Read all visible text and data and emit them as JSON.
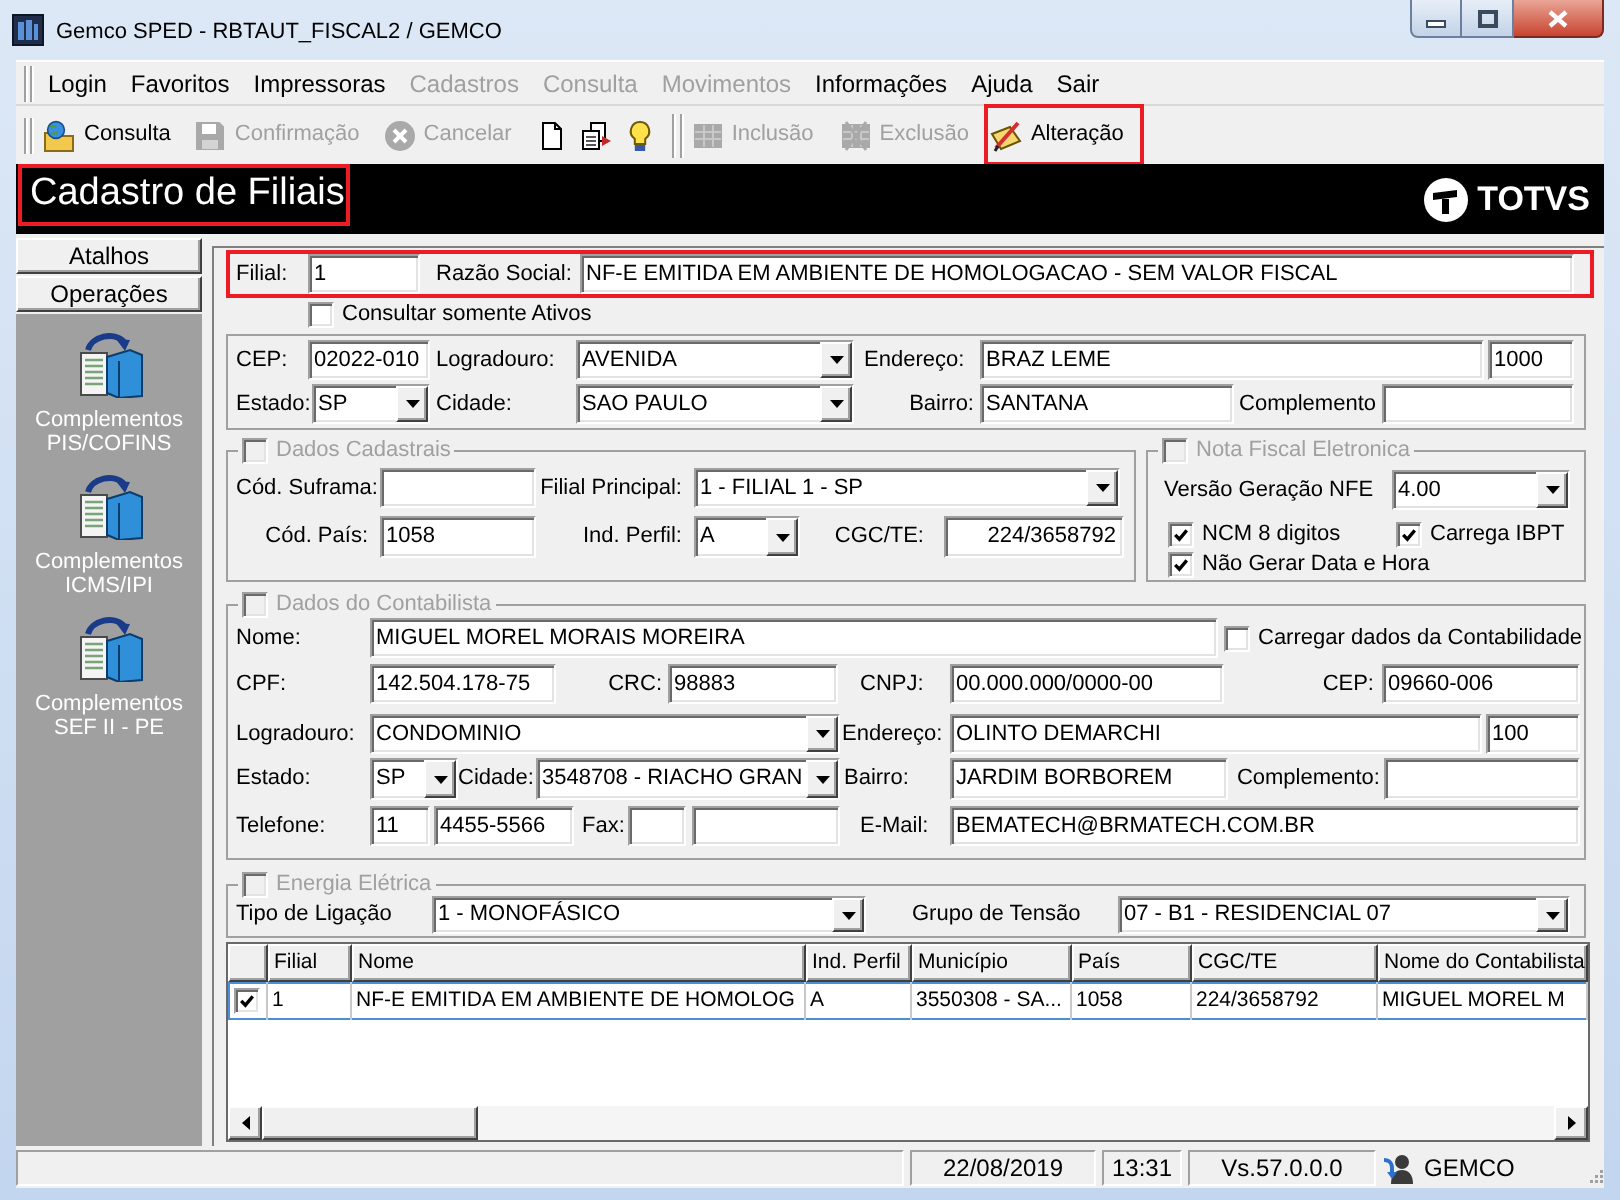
{
  "window": {
    "title": "Gemco SPED - RBTAUT_FISCAL2 / GEMCO"
  },
  "menu": [
    {
      "label": "Login",
      "disabled": false
    },
    {
      "label": "Favoritos",
      "disabled": false
    },
    {
      "label": "Impressoras",
      "disabled": false
    },
    {
      "label": "Cadastros",
      "disabled": true
    },
    {
      "label": "Consulta",
      "disabled": true
    },
    {
      "label": "Movimentos",
      "disabled": true
    },
    {
      "label": "Informações",
      "disabled": false
    },
    {
      "label": "Ajuda",
      "disabled": false
    },
    {
      "label": "Sair",
      "disabled": false
    }
  ],
  "toolbar": [
    {
      "kind": "button",
      "label": "Consulta",
      "disabled": false,
      "highlighted": false
    },
    {
      "kind": "button",
      "label": "Confirmação",
      "disabled": true,
      "highlighted": false
    },
    {
      "kind": "button",
      "label": "Cancelar",
      "disabled": true,
      "highlighted": false
    },
    {
      "kind": "icon_button",
      "disabled": false,
      "highlighted": false
    },
    {
      "kind": "icon_button",
      "disabled": false,
      "highlighted": false
    },
    {
      "kind": "icon_button",
      "disabled": false,
      "highlighted": false
    },
    {
      "kind": "separator"
    },
    {
      "kind": "button",
      "label": "Inclusão",
      "disabled": true,
      "highlighted": false
    },
    {
      "kind": "button",
      "label": "Exclusão",
      "disabled": true,
      "highlighted": false
    },
    {
      "kind": "button",
      "label": "Alteração",
      "disabled": false,
      "highlighted": true
    }
  ],
  "header": {
    "title": "Cadastro de Filiais",
    "highlighted": true,
    "logo_text": "TOTVS"
  },
  "sidebar": {
    "tabs": [
      "Atalhos",
      "Operações"
    ],
    "items": [
      "Complementos PIS/COFINS",
      "Complementos ICMS/IPI",
      "Complementos SEF II - PE"
    ]
  },
  "form": {
    "filial_row": {
      "highlighted": true,
      "items": [
        {
          "kind": "label",
          "text": "Filial:"
        },
        {
          "kind": "input",
          "value": "1"
        },
        {
          "kind": "label",
          "text": "Razão Social:"
        },
        {
          "kind": "input",
          "value": "NF-E EMITIDA EM AMBIENTE DE HOMOLOGACAO - SEM VALOR FISCAL"
        }
      ]
    },
    "only_active": {
      "label": "Consultar somente Ativos",
      "checked": false
    },
    "address": {
      "rows": [
        [
          {
            "kind": "label",
            "text": "CEP:"
          },
          {
            "kind": "input",
            "value": "02022-010"
          },
          {
            "kind": "label",
            "text": "Logradouro:"
          },
          {
            "kind": "combo",
            "value": "AVENIDA"
          },
          {
            "kind": "label",
            "text": "Endereço:"
          },
          {
            "kind": "input",
            "value": "BRAZ LEME"
          },
          {
            "kind": "input",
            "value": "1000"
          }
        ],
        [
          {
            "kind": "label",
            "text": "Estado:"
          },
          {
            "kind": "combo",
            "value": "SP"
          },
          {
            "kind": "label",
            "text": "Cidade:"
          },
          {
            "kind": "combo",
            "value": "SAO PAULO"
          },
          {
            "kind": "label",
            "text": "Bairro:"
          },
          {
            "kind": "input",
            "value": "SANTANA"
          },
          {
            "kind": "label",
            "text": "Complemento"
          },
          {
            "kind": "input"
          }
        ]
      ]
    },
    "dados_cadastrais": {
      "title": "Dados Cadastrais",
      "checked": false,
      "disabled": true,
      "rows": [
        [
          {
            "kind": "label",
            "text": "Cód. Suframa:"
          },
          {
            "kind": "input"
          },
          {
            "kind": "label",
            "text": "Filial Principal:"
          },
          {
            "kind": "combo",
            "value": "1 - FILIAL 1 - SP"
          }
        ],
        [
          {
            "kind": "label",
            "text": "Cód. País:"
          },
          {
            "kind": "input",
            "value": "1058"
          },
          {
            "kind": "label",
            "text": "Ind. Perfil:"
          },
          {
            "kind": "combo",
            "value": "A"
          },
          {
            "kind": "label",
            "text": "CGC/TE:"
          },
          {
            "kind": "input",
            "value": "224/3658792"
          }
        ]
      ]
    },
    "nota_fiscal": {
      "title": "Nota Fiscal Eletronica",
      "checked": false,
      "disabled": true,
      "rows": [
        [
          {
            "kind": "label",
            "text": "Versão Geração NFE"
          },
          {
            "kind": "combo",
            "value": "4.00"
          }
        ],
        [
          {
            "kind": "check",
            "label": "NCM 8 digitos",
            "checked": true
          },
          {
            "kind": "check",
            "label": "Carrega IBPT",
            "checked": true
          }
        ],
        [
          {
            "kind": "check",
            "label": "Não Gerar Data e Hora",
            "checked": true
          }
        ]
      ]
    },
    "contabilista": {
      "title": "Dados do Contabilista",
      "checked": false,
      "disabled": true,
      "items": [
        {
          "kind": "label",
          "text": "Nome:"
        },
        {
          "kind": "input",
          "value": "MIGUEL MOREL MORAIS MOREIRA"
        },
        {
          "kind": "check",
          "label": "Carregar dados da Contabilidade",
          "checked": false
        },
        {
          "kind": "label",
          "text": "CPF:"
        },
        {
          "kind": "input",
          "value": "142.504.178-75"
        },
        {
          "kind": "label",
          "text": "CRC:"
        },
        {
          "kind": "input",
          "value": "98883"
        },
        {
          "kind": "label",
          "text": "CNPJ:"
        },
        {
          "kind": "input",
          "value": "00.000.000/0000-00"
        },
        {
          "kind": "label",
          "text": "CEP:"
        },
        {
          "kind": "input",
          "value": "09660-006"
        },
        {
          "kind": "label",
          "text": "Logradouro:"
        },
        {
          "kind": "combo",
          "value": "CONDOMINIO"
        },
        {
          "kind": "label",
          "text": "Endereço:"
        },
        {
          "kind": "input",
          "value": "OLINTO DEMARCHI"
        },
        {
          "kind": "input",
          "value": "100"
        },
        {
          "kind": "label",
          "text": "Estado:"
        },
        {
          "kind": "combo",
          "value": "SP"
        },
        {
          "kind": "label",
          "text": "Cidade:"
        },
        {
          "kind": "combo",
          "value": "3548708 - RIACHO GRAN"
        },
        {
          "kind": "label",
          "text": "Bairro:"
        },
        {
          "kind": "input",
          "value": "JARDIM BORBOREM"
        },
        {
          "kind": "label",
          "text": "Complemento:"
        },
        {
          "kind": "input"
        },
        {
          "kind": "label",
          "text": "Telefone:"
        },
        {
          "kind": "input",
          "value": "11"
        },
        {
          "kind": "input",
          "value": "4455-5566"
        },
        {
          "kind": "label",
          "text": "Fax:"
        },
        {
          "kind": "input"
        },
        {
          "kind": "input"
        },
        {
          "kind": "label",
          "text": "E-Mail:"
        },
        {
          "kind": "input",
          "value": "BEMATECH@BRMATECH.COM.BR"
        }
      ]
    },
    "energia": {
      "title": "Energia Elétrica",
      "checked": false,
      "disabled": true,
      "rows": [
        [
          {
            "kind": "label",
            "text": "Tipo de Ligação"
          },
          {
            "kind": "combo",
            "value": "1 - MONOFÁSICO"
          },
          {
            "kind": "label",
            "text": "Grupo de Tensão"
          },
          {
            "kind": "combo",
            "value": "07 - B1 - RESIDENCIAL 07"
          }
        ]
      ]
    }
  },
  "grid": {
    "columns": [
      "Filial",
      "Nome",
      "Ind. Perfil",
      "Município",
      "País",
      "CGC/TE",
      "Nome do Contabilista"
    ],
    "rows": [
      {
        "checked": true,
        "selected": true,
        "cells": [
          "1",
          "NF-E EMITIDA EM AMBIENTE DE HOMOLOG",
          "A",
          "3550308 - SA...",
          "1058",
          "224/3658792",
          "MIGUEL MOREL M"
        ]
      }
    ]
  },
  "status_bar": {
    "panels": [
      "22/08/2019",
      "13:31",
      "Vs.57.0.0.0"
    ],
    "user": "GEMCO"
  }
}
